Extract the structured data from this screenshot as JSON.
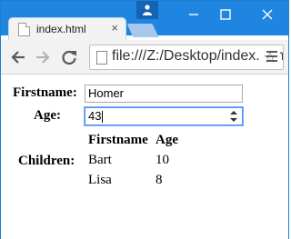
{
  "browser": {
    "tab_title": "index.html",
    "tab_close": "×",
    "url": "file:///Z:/Desktop/index.html",
    "star_icon": "star-icon",
    "accent": "#1e86e0"
  },
  "form": {
    "firstname_label": "Firstname:",
    "firstname_value": "Homer",
    "age_label": "Age:",
    "age_value": "43",
    "children_label": "Children:",
    "children_table": {
      "headers": [
        "Firstname",
        "Age"
      ],
      "rows": [
        [
          "Bart",
          "10"
        ],
        [
          "Lisa",
          "8"
        ]
      ]
    }
  }
}
